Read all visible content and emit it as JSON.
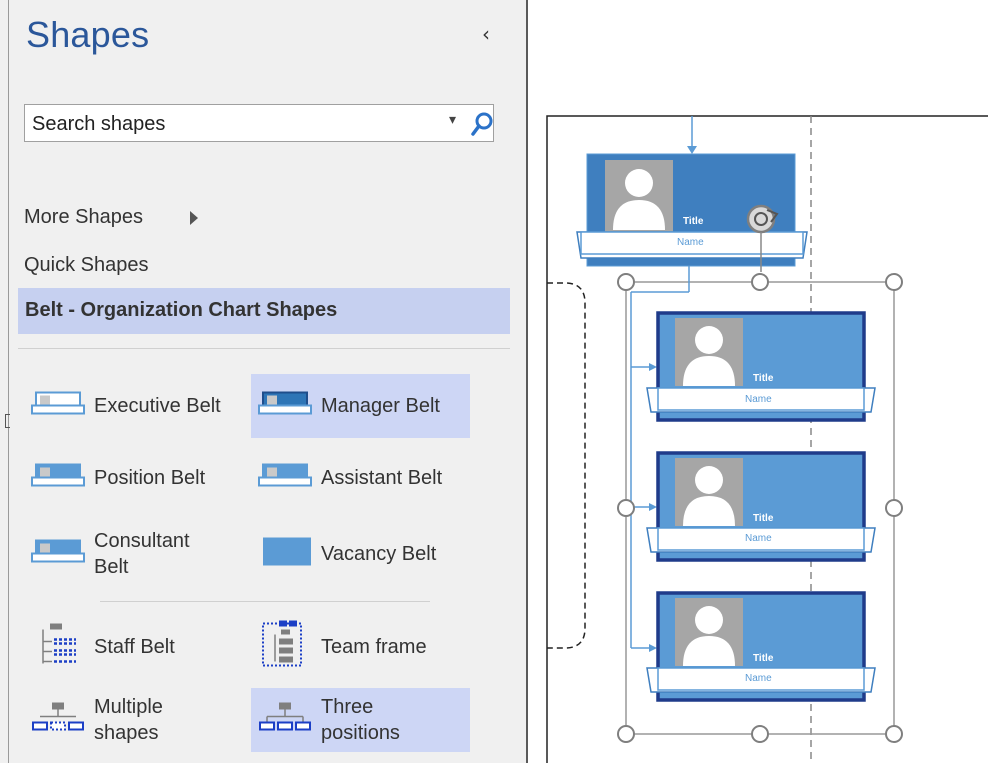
{
  "pane": {
    "title": "Shapes",
    "collapse_glyph": "‹",
    "search": {
      "value": "Search shapes",
      "dropdown_glyph": "▾"
    },
    "more_shapes": "More Shapes",
    "quick_shapes": "Quick Shapes",
    "stencil_title": "Belt - Organization Chart Shapes",
    "shapes": [
      {
        "label": "Executive Belt",
        "icon": "executive-belt-icon",
        "selected": false
      },
      {
        "label": "Manager Belt",
        "icon": "manager-belt-icon",
        "selected": true
      },
      {
        "label": "Position Belt",
        "icon": "position-belt-icon",
        "selected": false
      },
      {
        "label": "Assistant Belt",
        "icon": "assistant-belt-icon",
        "selected": false
      },
      {
        "label": "Consultant\nBelt",
        "icon": "consultant-belt-icon",
        "selected": false
      },
      {
        "label": "Vacancy Belt",
        "icon": "vacancy-belt-icon",
        "selected": false
      },
      {
        "label": "Staff Belt",
        "icon": "staff-belt-icon",
        "selected": false
      },
      {
        "label": "Team frame",
        "icon": "team-frame-icon",
        "selected": false
      },
      {
        "label": "Multiple\nshapes",
        "icon": "multiple-shapes-icon",
        "selected": false
      },
      {
        "label": "Three\npositions",
        "icon": "three-positions-icon",
        "selected": true
      }
    ]
  },
  "canvas": {
    "top_card": {
      "title": "Title",
      "name": "Name"
    },
    "cards": [
      {
        "title": "Title",
        "name": "Name"
      },
      {
        "title": "Title",
        "name": "Name"
      },
      {
        "title": "Title",
        "name": "Name"
      }
    ]
  },
  "colors": {
    "pane_bg": "#f0f0f0",
    "accent": "#2b579a",
    "selection": "#cdd6f5",
    "card_fill": "#5b9bd5",
    "card_border": "#1f3b8a",
    "photo_gray": "#a6a6a6",
    "connector": "#5b9bd5"
  }
}
